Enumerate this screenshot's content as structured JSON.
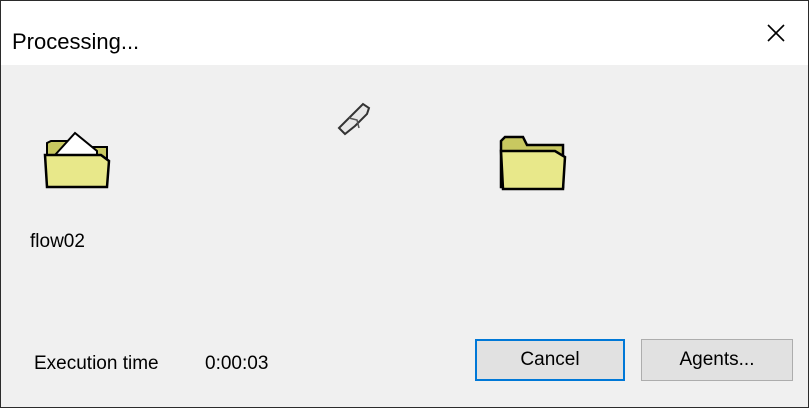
{
  "window": {
    "title": "Processing...",
    "close_glyph": "close-icon"
  },
  "animation": {
    "source_folder_icon": "open-folder-icon",
    "flying_paper_icon": "paper-icon",
    "destination_folder_icon": "folder-icon",
    "source_label": "flow02"
  },
  "status": {
    "execution_time_label": "Execution time",
    "execution_time_value": "0:00:03"
  },
  "buttons": {
    "cancel_label": "Cancel",
    "agents_label": "Agents..."
  },
  "colors": {
    "folder_fill": "#e8e88a",
    "folder_outline": "#000000",
    "dialog_bg": "#f0f0f0",
    "focus_border": "#0078d7"
  }
}
